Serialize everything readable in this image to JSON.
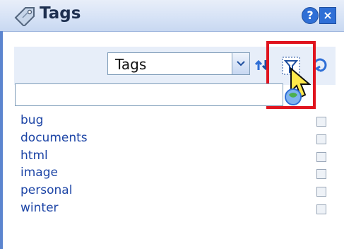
{
  "panel": {
    "title": "Tags",
    "help_label": "?",
    "close_label": "×"
  },
  "toolbar": {
    "select_value": "Tags"
  },
  "search": {
    "placeholder": ""
  },
  "tags": [
    {
      "label": "bug"
    },
    {
      "label": "documents"
    },
    {
      "label": "html"
    },
    {
      "label": "image"
    },
    {
      "label": "personal"
    },
    {
      "label": "winter"
    }
  ],
  "colors": {
    "accent": "#2f6fd6",
    "link": "#1d45a6",
    "highlight": "#e0141e"
  }
}
